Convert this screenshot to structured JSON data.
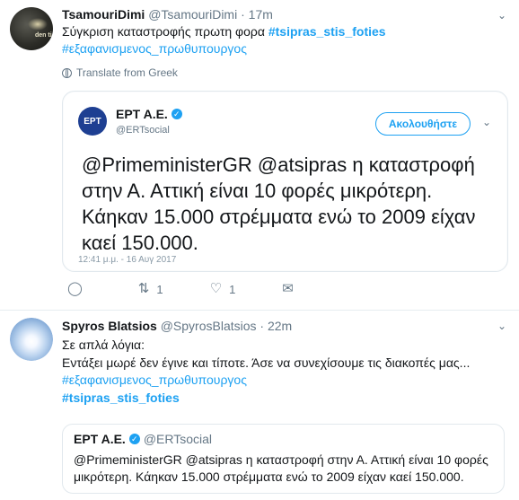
{
  "tweet1": {
    "author_name": "TsamouriDimi",
    "author_handle": "@TsamouriDimi",
    "time": "17m",
    "avatar_text": "den ti",
    "text_prefix": "Σύγκριση καταστροφής πρωτη φορα",
    "hashtag1": "#tsipras_stis_foties",
    "hashtag2": "#εξαφανισμενος_πρωθυπουργος",
    "translate_label": "Translate from Greek",
    "card": {
      "logo_text": "ΕΡΤ",
      "name": "ΕΡΤ Α.Ε.",
      "handle": "@ERTsocial",
      "follow_label": "Ακολουθήστε",
      "text": "@PrimeministerGR @atsipras η καταστροφή στην Α. Αττική είναι 10 φορές μικρότερη. Κάηκαν  15.000 στρέμματα ενώ το 2009 είχαν καεί 150.000.",
      "timestamp": "12:41 μ.μ. - 16 Αυγ 2017"
    },
    "retweet_count": "1",
    "like_count": "1"
  },
  "tweet2": {
    "author_name": "Spyros Blatsios",
    "author_handle": "@SpyrosBlatsios",
    "time": "22m",
    "line1": "Σε απλά λόγια:",
    "line2": "Εντάξει μωρέ δεν έγινε και τίποτε. Άσε να συνεχίσουμε τις διακοπές μας...",
    "hashtag1": "#εξαφανισμενος_πρωθυπουργος",
    "hashtag2": "#tsipras_stis_foties",
    "quote": {
      "name": "ΕΡΤ Α.Ε.",
      "handle": "@ERTsocial",
      "text": "@PrimeministerGR @atsipras η καταστροφή στην Α. Αττική είναι 10 φορές μικρότερη. Κάηκαν  15.000 στρέμματα ενώ το 2009 είχαν καεί 150.000."
    }
  },
  "colors": {
    "link": "#1da1f2",
    "text": "#14171a",
    "secondary": "#657786",
    "border": "#e6ecf0",
    "ert_logo": "#1e3f92"
  }
}
